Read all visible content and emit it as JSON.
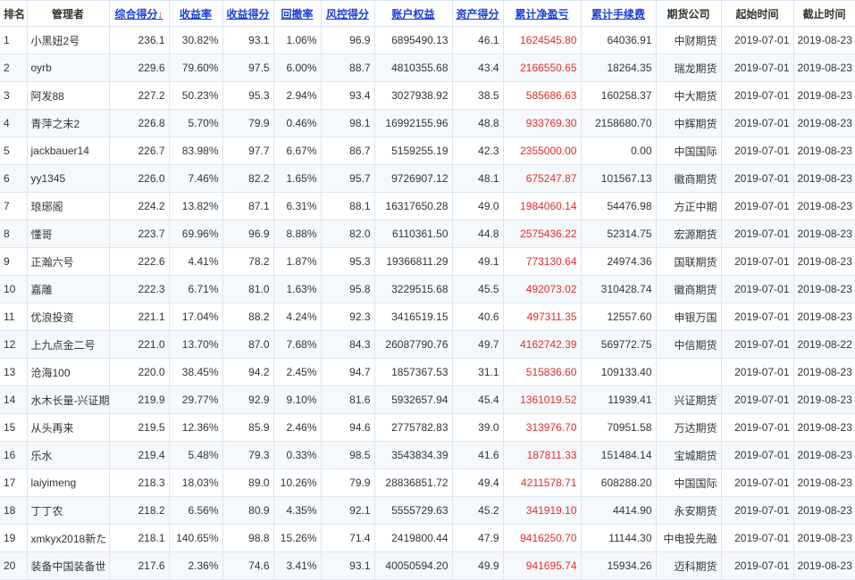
{
  "headers": {
    "rank": "排名",
    "manager": "管理者",
    "total_score": "综合得分",
    "total_score_sort": "↓",
    "return_rate": "收益率",
    "return_score": "收益得分",
    "drawdown": "回撤率",
    "risk_score": "风控得分",
    "equity": "账户权益",
    "asset_score": "资产得分",
    "profit": "累计净盈亏",
    "fees": "累计手续费",
    "company": "期货公司",
    "start": "起始时间",
    "end": "截止时间"
  },
  "colors": {
    "link": "#1a3fd6",
    "profit_red": "#e52b2b",
    "grid": "#d9e6f2"
  },
  "rows": [
    {
      "rank": "1",
      "name": "小黑妞2号",
      "score": "236.1",
      "ret": "30.82%",
      "ret_score": "93.1",
      "dd": "1.06%",
      "risk": "96.9",
      "equity": "6895490.13",
      "asset": "46.1",
      "profit": "1624545.80",
      "fees": "64036.91",
      "company": "中财期货",
      "start": "2019-07-01",
      "end": "2019-08-23"
    },
    {
      "rank": "2",
      "name": "oyrb",
      "score": "229.6",
      "ret": "79.60%",
      "ret_score": "97.5",
      "dd": "6.00%",
      "risk": "88.7",
      "equity": "4810355.68",
      "asset": "43.4",
      "profit": "2166550.65",
      "fees": "18264.35",
      "company": "瑞龙期货",
      "start": "2019-07-01",
      "end": "2019-08-23"
    },
    {
      "rank": "3",
      "name": "阿发88",
      "score": "227.2",
      "ret": "50.23%",
      "ret_score": "95.3",
      "dd": "2.94%",
      "risk": "93.4",
      "equity": "3027938.92",
      "asset": "38.5",
      "profit": "585686.63",
      "fees": "160258.37",
      "company": "中大期货",
      "start": "2019-07-01",
      "end": "2019-08-23"
    },
    {
      "rank": "4",
      "name": "青萍之末2",
      "score": "226.8",
      "ret": "5.70%",
      "ret_score": "79.9",
      "dd": "0.46%",
      "risk": "98.1",
      "equity": "16992155.96",
      "asset": "48.8",
      "profit": "933769.30",
      "fees": "2158680.70",
      "company": "中辉期货",
      "start": "2019-07-01",
      "end": "2019-08-23"
    },
    {
      "rank": "5",
      "name": "jackbauer14",
      "score": "226.7",
      "ret": "83.98%",
      "ret_score": "97.7",
      "dd": "6.67%",
      "risk": "86.7",
      "equity": "5159255.19",
      "asset": "42.3",
      "profit": "2355000.00",
      "fees": "0.00",
      "company": "中国国际",
      "start": "2019-07-01",
      "end": "2019-08-23"
    },
    {
      "rank": "6",
      "name": "yy1345",
      "score": "226.0",
      "ret": "7.46%",
      "ret_score": "82.2",
      "dd": "1.65%",
      "risk": "95.7",
      "equity": "9726907.12",
      "asset": "48.1",
      "profit": "675247.87",
      "fees": "101567.13",
      "company": "徽商期货",
      "start": "2019-07-01",
      "end": "2019-08-23"
    },
    {
      "rank": "7",
      "name": "琅琊阁",
      "score": "224.2",
      "ret": "13.82%",
      "ret_score": "87.1",
      "dd": "6.31%",
      "risk": "88.1",
      "equity": "16317650.28",
      "asset": "49.0",
      "profit": "1984060.14",
      "fees": "54476.98",
      "company": "方正中期",
      "start": "2019-07-01",
      "end": "2019-08-23"
    },
    {
      "rank": "8",
      "name": "懂哥",
      "score": "223.7",
      "ret": "69.96%",
      "ret_score": "96.9",
      "dd": "8.88%",
      "risk": "82.0",
      "equity": "6110361.50",
      "asset": "44.8",
      "profit": "2575436.22",
      "fees": "52314.75",
      "company": "宏源期货",
      "start": "2019-07-01",
      "end": "2019-08-23"
    },
    {
      "rank": "9",
      "name": "正瀚六号",
      "score": "222.6",
      "ret": "4.41%",
      "ret_score": "78.2",
      "dd": "1.87%",
      "risk": "95.3",
      "equity": "19366811.29",
      "asset": "49.1",
      "profit": "773130.64",
      "fees": "24974.36",
      "company": "国联期货",
      "start": "2019-07-01",
      "end": "2019-08-23"
    },
    {
      "rank": "10",
      "name": "嘉雕",
      "score": "222.3",
      "ret": "6.71%",
      "ret_score": "81.0",
      "dd": "1.63%",
      "risk": "95.8",
      "equity": "3229515.68",
      "asset": "45.5",
      "profit": "492073.02",
      "fees": "310428.74",
      "company": "徽商期货",
      "start": "2019-07-01",
      "end": "2019-08-23"
    },
    {
      "rank": "11",
      "name": "优浪投资",
      "score": "221.1",
      "ret": "17.04%",
      "ret_score": "88.2",
      "dd": "4.24%",
      "risk": "92.3",
      "equity": "3416519.15",
      "asset": "40.6",
      "profit": "497311.35",
      "fees": "12557.60",
      "company": "申银万国",
      "start": "2019-07-01",
      "end": "2019-08-23"
    },
    {
      "rank": "12",
      "name": "上九点金二号",
      "score": "221.0",
      "ret": "13.70%",
      "ret_score": "87.0",
      "dd": "7.68%",
      "risk": "84.3",
      "equity": "26087790.76",
      "asset": "49.7",
      "profit": "4162742.39",
      "fees": "569772.75",
      "company": "中信期货",
      "start": "2019-07-01",
      "end": "2019-08-22"
    },
    {
      "rank": "13",
      "name": "沧海100",
      "score": "220.0",
      "ret": "38.45%",
      "ret_score": "94.2",
      "dd": "2.45%",
      "risk": "94.7",
      "equity": "1857367.53",
      "asset": "31.1",
      "profit": "515836.60",
      "fees": "109133.40",
      "company": "",
      "start": "2019-07-01",
      "end": "2019-08-23"
    },
    {
      "rank": "14",
      "name": "水木长量-兴证期",
      "score": "219.9",
      "ret": "29.77%",
      "ret_score": "92.9",
      "dd": "9.10%",
      "risk": "81.6",
      "equity": "5932657.94",
      "asset": "45.4",
      "profit": "1361019.52",
      "fees": "11939.41",
      "company": "兴证期货",
      "start": "2019-07-01",
      "end": "2019-08-23"
    },
    {
      "rank": "15",
      "name": "从头再来",
      "score": "219.5",
      "ret": "12.36%",
      "ret_score": "85.9",
      "dd": "2.46%",
      "risk": "94.6",
      "equity": "2775782.83",
      "asset": "39.0",
      "profit": "313976.70",
      "fees": "70951.58",
      "company": "万达期货",
      "start": "2019-07-01",
      "end": "2019-08-23"
    },
    {
      "rank": "16",
      "name": "乐水",
      "score": "219.4",
      "ret": "5.48%",
      "ret_score": "79.3",
      "dd": "0.33%",
      "risk": "98.5",
      "equity": "3543834.39",
      "asset": "41.6",
      "profit": "187811.33",
      "fees": "151484.14",
      "company": "宝城期货",
      "start": "2019-07-01",
      "end": "2019-08-23"
    },
    {
      "rank": "17",
      "name": "laiyimeng",
      "score": "218.3",
      "ret": "18.03%",
      "ret_score": "89.0",
      "dd": "10.26%",
      "risk": "79.9",
      "equity": "28836851.72",
      "asset": "49.4",
      "profit": "4211578.71",
      "fees": "608288.20",
      "company": "中国国际",
      "start": "2019-07-01",
      "end": "2019-08-23"
    },
    {
      "rank": "18",
      "name": "丁丁农",
      "score": "218.2",
      "ret": "6.56%",
      "ret_score": "80.9",
      "dd": "4.35%",
      "risk": "92.1",
      "equity": "5555729.63",
      "asset": "45.2",
      "profit": "341919.10",
      "fees": "4414.90",
      "company": "永安期货",
      "start": "2019-07-01",
      "end": "2019-08-23"
    },
    {
      "rank": "19",
      "name": "xmkyx2018新た",
      "score": "218.1",
      "ret": "140.65%",
      "ret_score": "98.8",
      "dd": "15.26%",
      "risk": "71.4",
      "equity": "2419800.44",
      "asset": "47.9",
      "profit": "9416250.70",
      "fees": "11144.30",
      "company": "中电投先融",
      "start": "2019-07-01",
      "end": "2019-08-23"
    },
    {
      "rank": "20",
      "name": "装备中国装备世",
      "score": "217.6",
      "ret": "2.36%",
      "ret_score": "74.6",
      "dd": "3.41%",
      "risk": "93.1",
      "equity": "40050594.20",
      "asset": "49.9",
      "profit": "941695.74",
      "fees": "15934.26",
      "company": "迈科期货",
      "start": "2019-07-01",
      "end": "2019-08-23"
    }
  ]
}
